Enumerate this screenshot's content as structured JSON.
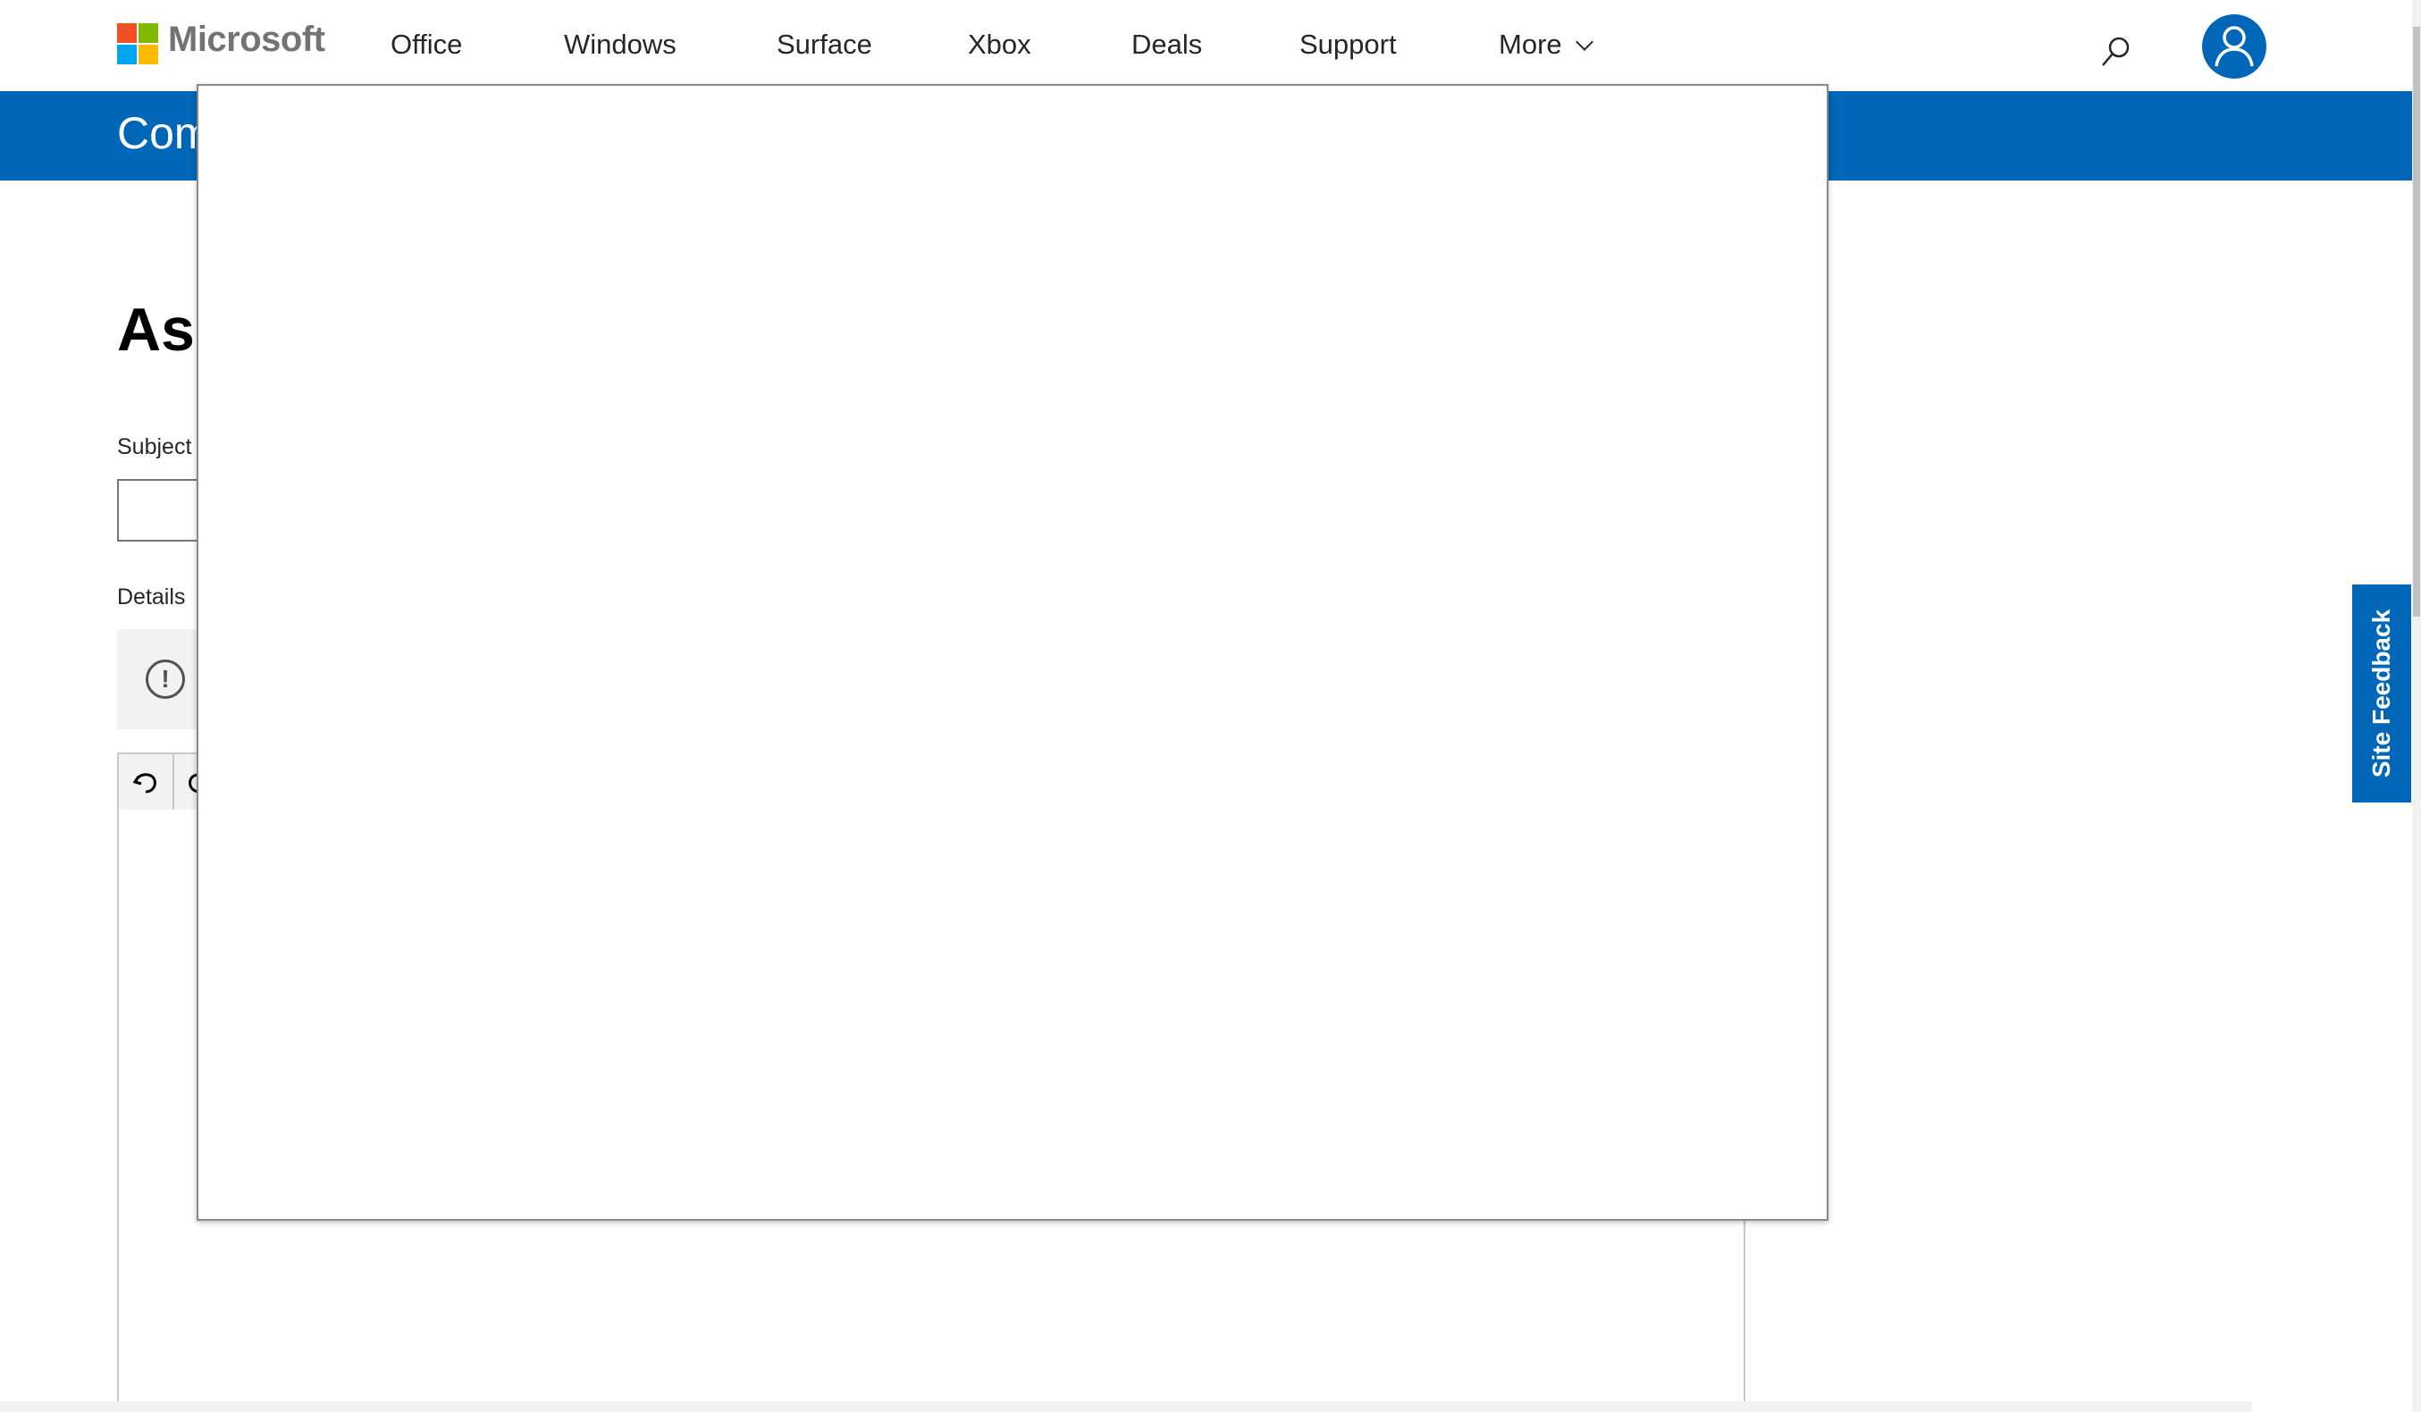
{
  "header": {
    "brand": "Microsoft",
    "nav": [
      "Office",
      "Windows",
      "Surface",
      "Xbox",
      "Deals",
      "Support",
      "More"
    ],
    "icons": {
      "search": "search-icon",
      "account": "user-account-icon",
      "more": "chevron-down-icon"
    },
    "logo_colors": [
      "#f25022",
      "#7fba00",
      "#00a4ef",
      "#ffb900"
    ]
  },
  "band": {
    "title": "Com"
  },
  "main": {
    "heading": "Ask",
    "subject_label": "Subject",
    "details_label": "Details",
    "toolbar_icons": [
      "undo-icon",
      "redo-icon"
    ]
  },
  "feedback": {
    "label": "Site Feedback"
  },
  "colors": {
    "accent": "#0067b8"
  }
}
